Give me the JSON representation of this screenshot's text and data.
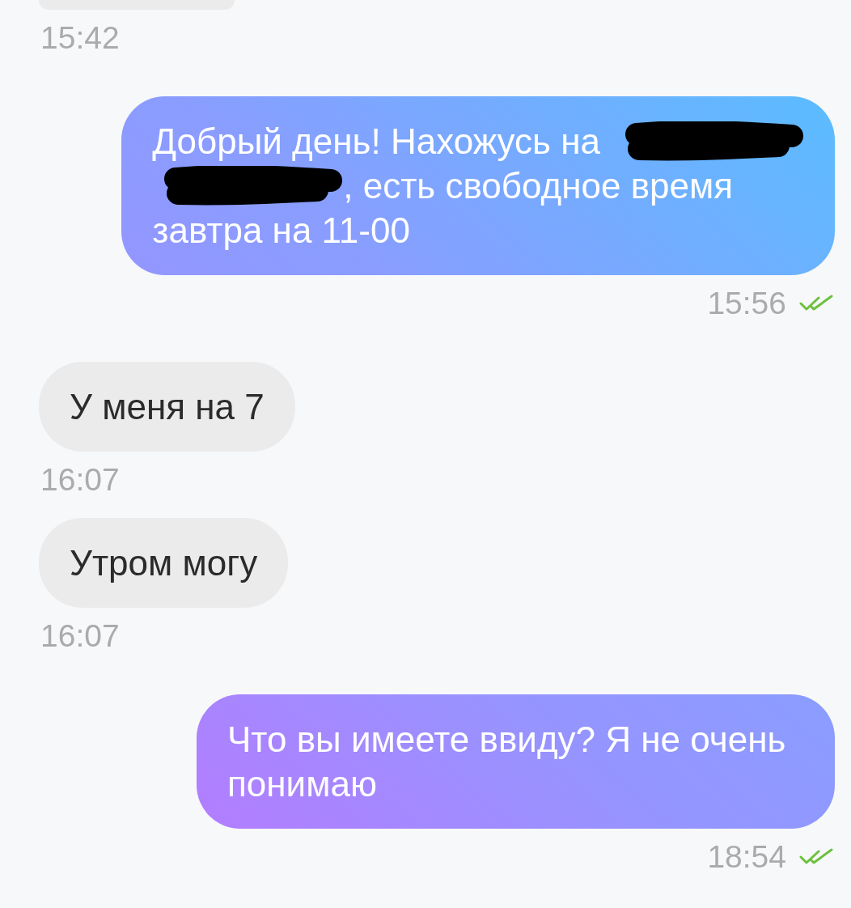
{
  "conversation": {
    "messages": [
      {
        "kind": "incoming",
        "time": "15:42"
      },
      {
        "kind": "outgoing",
        "lines": [
          [
            {
              "kind": "text",
              "text": "Добрый день! Нахожусь на"
            },
            {
              "kind": "redaction"
            }
          ],
          [
            {
              "kind": "redaction"
            },
            {
              "kind": "text",
              "text": ", есть свободное время"
            }
          ],
          [
            {
              "kind": "text",
              "text": "завтра на 11-00"
            }
          ]
        ],
        "time": "15:56",
        "read": true
      },
      {
        "kind": "incoming",
        "text": "У меня на 7",
        "time": "16:07"
      },
      {
        "kind": "incoming",
        "text": "Утром могу",
        "time": "16:07"
      },
      {
        "kind": "outgoing",
        "text": "Что вы имеете ввиду? Я не очень понимаю",
        "time": "18:54",
        "read": true
      }
    ]
  }
}
